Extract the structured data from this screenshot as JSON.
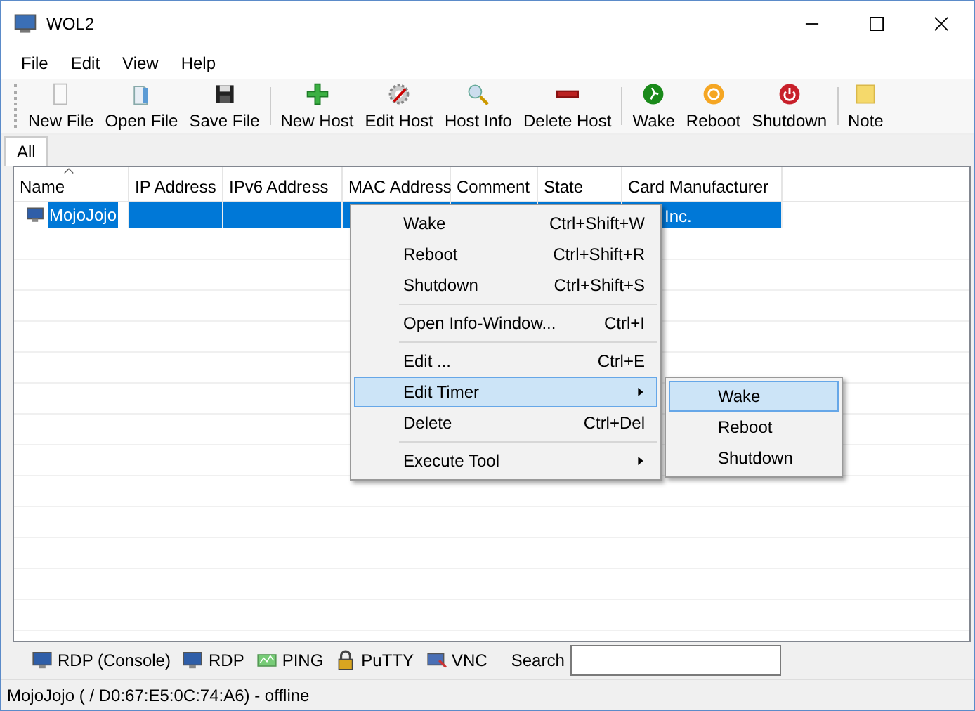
{
  "window": {
    "title": "WOL2"
  },
  "menu_bar": [
    "File",
    "Edit",
    "View",
    "Help"
  ],
  "toolbar": [
    [
      {
        "label": "New File",
        "kind": "page"
      },
      {
        "label": "Open File",
        "kind": "folder"
      },
      {
        "label": "Save File",
        "kind": "disk"
      }
    ],
    [
      {
        "label": "New Host",
        "kind": "plus"
      },
      {
        "label": "Edit Host",
        "kind": "gear"
      },
      {
        "label": "Host Info",
        "kind": "magnifier"
      },
      {
        "label": "Delete Host",
        "kind": "bar"
      }
    ],
    [
      {
        "label": "Wake",
        "kind": "runner"
      },
      {
        "label": "Reboot",
        "kind": "cycle"
      },
      {
        "label": "Shutdown",
        "kind": "power"
      }
    ],
    [
      {
        "label": "Note",
        "kind": "note"
      }
    ]
  ],
  "tabs": [
    {
      "label": "All",
      "selected": true
    }
  ],
  "table": {
    "columns": [
      "Name",
      "IP Address",
      "IPv6 Address",
      "MAC Address",
      "Comment",
      "State",
      "Card Manufacturer"
    ],
    "rows": [
      {
        "selected": true,
        "cells": [
          "MojoJojo",
          "",
          "",
          "",
          "",
          "",
          "Inc."
        ]
      }
    ]
  },
  "context_menu": {
    "groups": [
      [
        {
          "label": "Wake",
          "shortcut": "Ctrl+Shift+W",
          "submenu": false,
          "highlighted": false
        },
        {
          "label": "Reboot",
          "shortcut": "Ctrl+Shift+R",
          "submenu": false,
          "highlighted": false
        },
        {
          "label": "Shutdown",
          "shortcut": "Ctrl+Shift+S",
          "submenu": false,
          "highlighted": false
        }
      ],
      [
        {
          "label": "Open Info-Window...",
          "shortcut": "Ctrl+I",
          "submenu": false,
          "highlighted": false
        }
      ],
      [
        {
          "label": "Edit ...",
          "shortcut": "Ctrl+E",
          "submenu": false,
          "highlighted": false
        },
        {
          "label": "Edit Timer",
          "submenu": true,
          "highlighted": true
        },
        {
          "label": "Delete",
          "shortcut": "Ctrl+Del",
          "submenu": false,
          "highlighted": false
        }
      ],
      [
        {
          "label": "Execute Tool",
          "submenu": true,
          "highlighted": false
        }
      ]
    ]
  },
  "submenu": [
    {
      "label": "Wake",
      "highlighted": true
    },
    {
      "label": "Reboot",
      "highlighted": false
    },
    {
      "label": "Shutdown",
      "highlighted": false
    }
  ],
  "tools_bar": {
    "tools": [
      {
        "label": "RDP (Console)",
        "kind": "monitor"
      },
      {
        "label": "RDP",
        "kind": "monitor"
      },
      {
        "label": "PING",
        "kind": "ping"
      },
      {
        "label": "PuTTY",
        "kind": "lock"
      },
      {
        "label": "VNC",
        "kind": "vnc"
      }
    ],
    "search_label": "Search"
  },
  "status_bar": "MojoJojo ( / D0:67:E5:0C:74:A6) - offline"
}
